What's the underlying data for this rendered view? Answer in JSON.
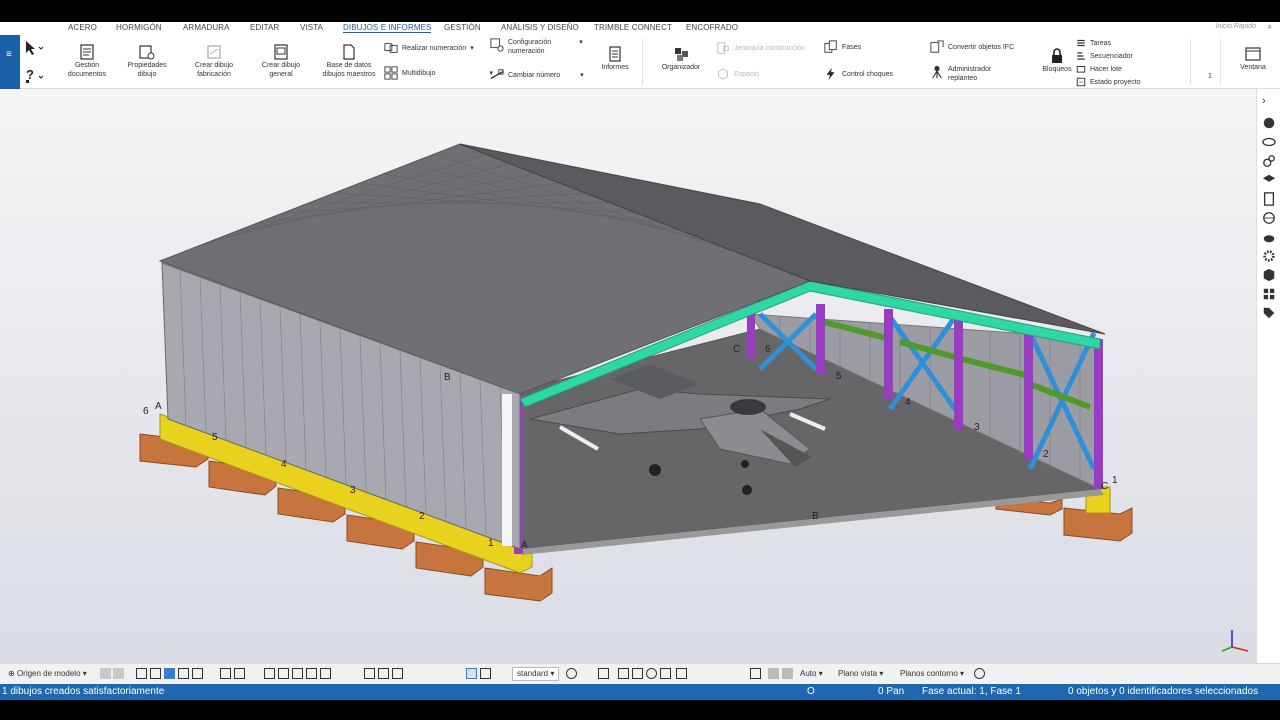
{
  "ribbon_tabs": [
    "ACERO",
    "HORMIGÓN",
    "ARMADURA",
    "EDITAR",
    "VISTA",
    "DIBUJOS E INFORMES",
    "GESTIÓN",
    "ANÁLISIS Y DISEÑO",
    "TRIMBLE CONNECT",
    "ENCOFRADO"
  ],
  "active_tab": "DIBUJOS E INFORMES",
  "quick_search": {
    "placeholder": "Inicio Rápido"
  },
  "ribbon": {
    "gestion_documentos": [
      "Gestión",
      "documentos"
    ],
    "propiedades_dibujo": [
      "Propiedades",
      "dibujo"
    ],
    "crear_dibujo_fabricacion": [
      "Crear dibujo",
      "fabricación"
    ],
    "crear_dibujo_general": [
      "Crear dibujo",
      "general"
    ],
    "base_datos": [
      "Base de datos",
      "dibujos maestros"
    ],
    "realizar_numeracion": "Realizar numeración",
    "multidibujo": "Multidibujo",
    "configuracion_numeracion": [
      "Configuración",
      "numeración"
    ],
    "cambiar_numero": "Cambiar número",
    "informes": "Informes",
    "organizador": "Organizador",
    "jerarquia": "Jerarquía construcción",
    "espacio": "Espacio",
    "fases": "Fases",
    "control_choques": "Control choques",
    "convertir_ifc": "Convertir objetos IFC",
    "administrador_replanteo": [
      "Administrador",
      "replanteo"
    ],
    "bloqueos": "Bloqueos",
    "tareas": "Tareas",
    "secuenciador": "Secuenciador",
    "hacer_lote": "Hacer lote",
    "estado_proyecto": "Estado proyecto",
    "count_1": "1",
    "ventana": "Ventana"
  },
  "grid_labels": {
    "row_letters": [
      "A",
      "B",
      "C",
      "A",
      "B",
      "C"
    ],
    "row_numbers": [
      "1",
      "2",
      "3",
      "4",
      "5",
      "6",
      "1",
      "2",
      "3",
      "4",
      "5",
      "6"
    ]
  },
  "bottom_toolbar": {
    "origen": "Origen de modelo",
    "standard": "standard",
    "auto": "Auto",
    "plano_vista": "Plano vista",
    "planos_contorno": "Planos contorno"
  },
  "status": {
    "message": "1 dibujos creados satisfactoriamente",
    "o_indicator": "O",
    "pan": "0 Pan",
    "fase": "Fase actual: 1, Fase 1",
    "seleccion": "0 objetos y 0 identificadores seleccionados"
  },
  "colors": {
    "accent_blue": "#1f67b0",
    "roof": "#6f6f74",
    "wall": "#9c9ca4",
    "foundation": "#c8743e",
    "beam_yellow": "#e8d21e",
    "frame_teal": "#2fd6a6",
    "column_purple": "#9a3bc4",
    "bracing_blue": "#2f8fd8",
    "girt_green": "#4f9a2a"
  }
}
